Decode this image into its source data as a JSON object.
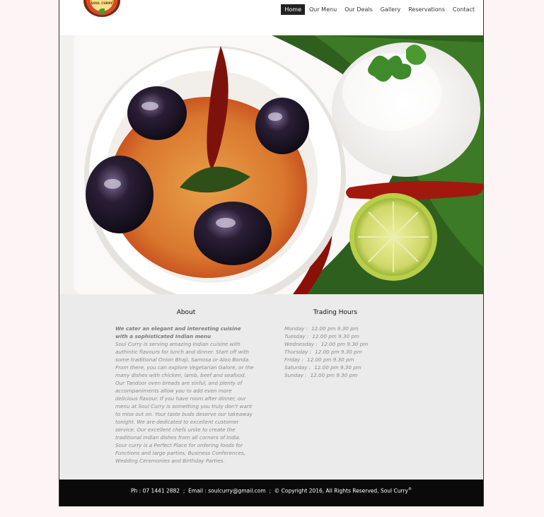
{
  "brand": {
    "logo_text": "SOUL CURRY"
  },
  "nav": {
    "items": [
      {
        "label": "Home",
        "active": true
      },
      {
        "label": "Our Menu",
        "active": false
      },
      {
        "label": "Our Deals",
        "active": false
      },
      {
        "label": "Gallery",
        "active": false
      },
      {
        "label": "Reservations",
        "active": false
      },
      {
        "label": "Contact",
        "active": false
      }
    ]
  },
  "about": {
    "title": "About",
    "lead": "We cater an elegant and interesting cuisine with a sophisticated Indian menu",
    "body": "Soul Curry is serving amazing Indian cuisine with authintic flavours for lunch and dinner. Start off with some traditional Onion Bhaji, Samosa or Aloo Bonda. From there, you can explore Vegetarian Galore, or the many dishes with chicken, lamb, beef and seafood. Our Tandoor oven breads are sinful, and plenty of accompaniments allow you to add even more delicious flavour. If you have room after dinner, our menu at Soul Curry is something you truly don't want to miss out on. Your taste buds deserve our takeaway tonight. We are dedicated to excellent customer service. Our excellent chefs unite to create the traditional Indian dishes from all corners of India.",
    "extra": "Sour curry is a Perfect Place for ordering foods for Functions and large parties, Business Conferences, Wedding Ceremonies and Birthday Parties."
  },
  "hours": {
    "title": "Trading Hours",
    "rows": [
      {
        "day": "Monday :",
        "time": "12.00 pm 9.30 pm"
      },
      {
        "day": "Tuesday :",
        "time": "12.00 pm 9.30 pm"
      },
      {
        "day": "Wednesday :",
        "time": "12.00 pm 9.30 pm"
      },
      {
        "day": "Thursday :",
        "time": "12.00 pm 9.30 pm"
      },
      {
        "day": "Friday :",
        "time": "12.00 pm 9.30 pm"
      },
      {
        "day": "Saturday :",
        "time": "12.00 pm 9.30 pm"
      },
      {
        "day": "Sunday :",
        "time": "12.00 pm 9.30 pm"
      }
    ]
  },
  "footer": {
    "phone": "Ph : 07 1441 2882",
    "sep1": ";",
    "email": "Email : soulcurry@gmail.com",
    "sep2": ";",
    "copyright": "© Copyright 2016,  All Rights Reserved,  Soul Curry",
    "mark": "®"
  },
  "colors": {
    "page_bg": "#fdf5f5",
    "info_bg": "#ebebeb",
    "footer_bg": "#0a0a0a",
    "nav_active_bg": "#222222",
    "muted_text": "#8a8a8a"
  }
}
